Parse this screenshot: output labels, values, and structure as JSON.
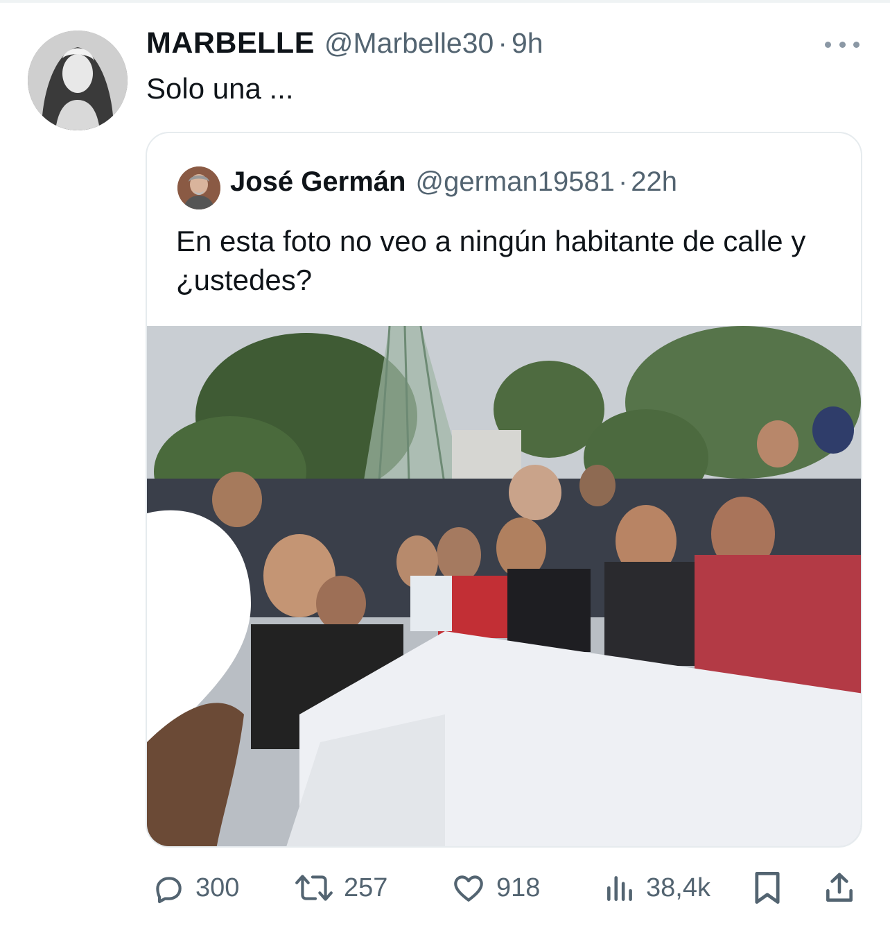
{
  "tweet": {
    "display_name": "MARBELLE",
    "handle": "@Marbelle30",
    "separator": "·",
    "time": "9h",
    "text": "Solo una ...",
    "avatar_icon": "profile-photo"
  },
  "quoted": {
    "display_name": "José Germán",
    "handle": "@german19581",
    "separator": "·",
    "time": "22h",
    "text": "En esta foto no veo a ningún habitante de calle y ¿ustedes?",
    "photo": "group-photo-at-table"
  },
  "actions": {
    "replies": "300",
    "reposts": "257",
    "likes": "918",
    "views": "38,4k"
  },
  "colors": {
    "text_primary": "#0f1419",
    "text_secondary": "#536471",
    "border": "#e6ebee"
  }
}
